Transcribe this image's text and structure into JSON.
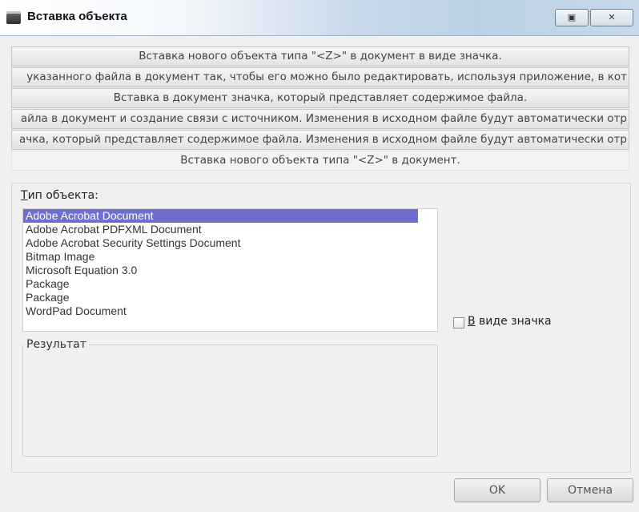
{
  "window": {
    "title": "Вставка объекта",
    "restore_glyph": "▣",
    "close_glyph": "✕"
  },
  "descriptions": [
    "Вставка нового объекта типа \"<Z>\" в документ в виде значка.",
    "указанного файла в документ так, чтобы его можно было редактировать, используя приложение, в кот",
    "Вставка в документ значка, который представляет содержимое файла.",
    "айла в документ и создание связи с источником.  Изменения в исходном файле будут автоматически отр",
    "ачка, который представляет содержимое файла. Изменения в исходном файле будут автоматически отр",
    "Вставка нового объекта типа \"<Z>\" в документ."
  ],
  "object_type": {
    "label_first": "Т",
    "label_rest": "ип объекта:",
    "items": [
      "Adobe Acrobat Document",
      "Adobe Acrobat PDFXML Document",
      "Adobe Acrobat Security Settings Document",
      "Bitmap Image",
      "Microsoft Equation 3.0",
      "Package",
      "Package",
      "WordPad Document"
    ],
    "selected_index": 0
  },
  "as_icon": {
    "label_first": "В",
    "label_rest": " виде значка",
    "checked": false
  },
  "result": {
    "legend": "Результат",
    "text": ""
  },
  "buttons": {
    "ok": "OK",
    "cancel": "Отмена"
  },
  "colors": {
    "selection": "#6f6fcf",
    "title_gradient_end": "#bcd1e6"
  }
}
